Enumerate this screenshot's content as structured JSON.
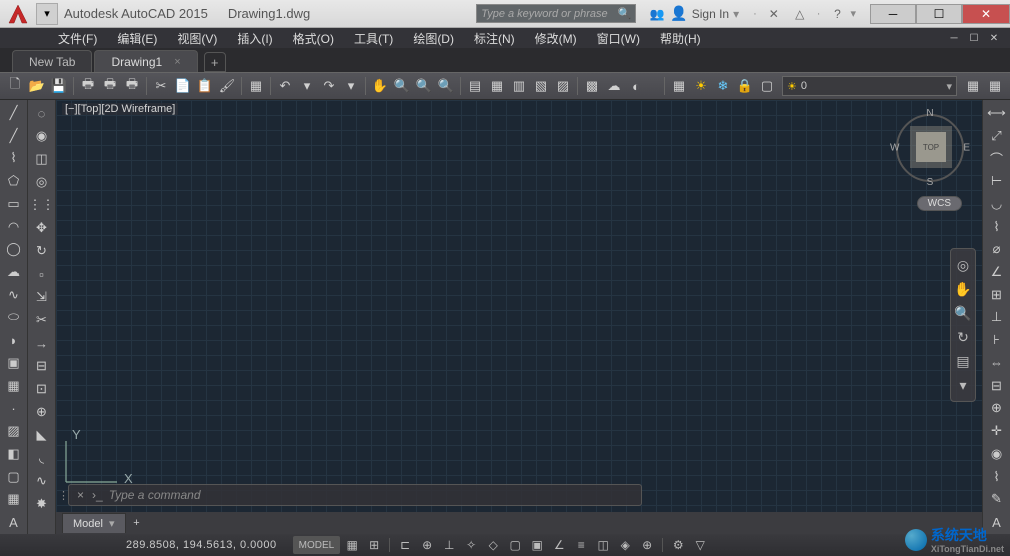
{
  "title": {
    "app": "Autodesk AutoCAD 2015",
    "doc": "Drawing1.dwg"
  },
  "search": {
    "placeholder": "Type a keyword or phrase"
  },
  "sign_in": {
    "label": "Sign In"
  },
  "menus": [
    "文件(F)",
    "编辑(E)",
    "视图(V)",
    "插入(I)",
    "格式(O)",
    "工具(T)",
    "绘图(D)",
    "标注(N)",
    "修改(M)",
    "窗口(W)",
    "帮助(H)"
  ],
  "tabs": [
    {
      "label": "New Tab",
      "active": false
    },
    {
      "label": "Drawing1",
      "active": true,
      "closable": true
    }
  ],
  "layer": {
    "current": "0"
  },
  "viewport_label": "[−][Top][2D Wireframe]",
  "viewcube": {
    "face": "TOP",
    "n": "N",
    "s": "S",
    "e": "E",
    "w": "W",
    "cs": "WCS"
  },
  "ucs": {
    "x": "X",
    "y": "Y"
  },
  "cmd": {
    "placeholder": "Type a command"
  },
  "layout": {
    "tab": "Model"
  },
  "status": {
    "coords": "289.8508, 194.5613, 0.0000",
    "model": "MODEL"
  },
  "watermark": {
    "line1": "系统天地",
    "line2": "XiTongTianDi.net"
  }
}
